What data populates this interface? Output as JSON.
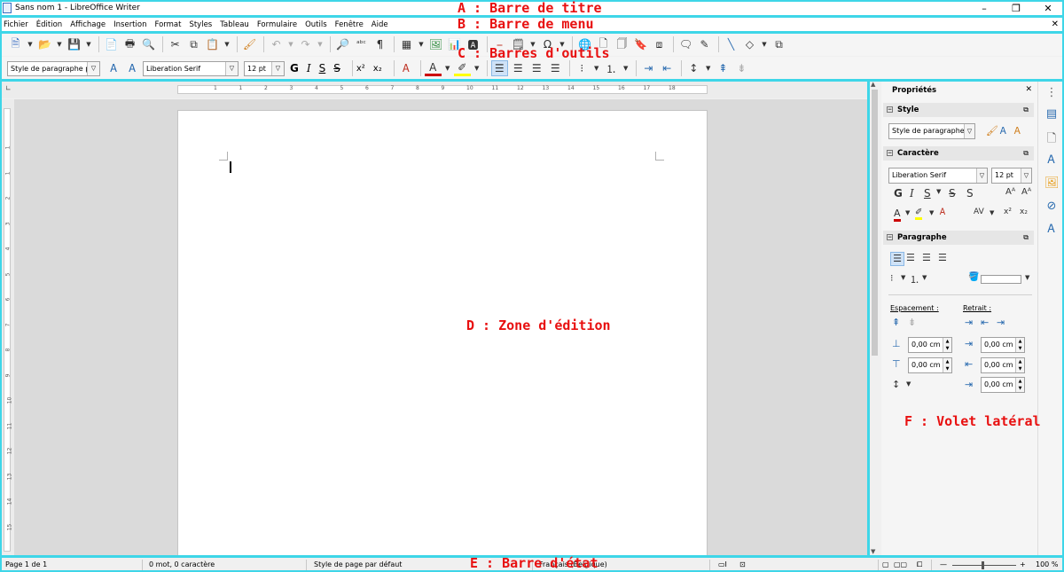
{
  "window": {
    "title": "Sans nom 1 - LibreOffice Writer",
    "minimize": "–",
    "restore": "❐",
    "close": "✕"
  },
  "menu": {
    "items": [
      "Fichier",
      "Édition",
      "Affichage",
      "Insertion",
      "Format",
      "Styles",
      "Tableau",
      "Formulaire",
      "Outils",
      "Fenêtre",
      "Aide"
    ],
    "close": "✕"
  },
  "toolbar": {
    "para_style": "Style de paragraphe par",
    "font_name": "Liberation Serif",
    "font_size": "12 pt",
    "bold": "G",
    "italic": "I",
    "underline": "S",
    "strike": "S",
    "superscript": "x²",
    "subscript": "x₂"
  },
  "ruler": {
    "numbers": [
      "1",
      "1",
      "2",
      "3",
      "4",
      "5",
      "6",
      "7",
      "8",
      "9",
      "10",
      "11",
      "12",
      "13",
      "14",
      "15",
      "16",
      "17",
      "18"
    ],
    "vnumbers": [
      "1",
      "1",
      "2",
      "3",
      "4",
      "5",
      "6",
      "7",
      "8",
      "9",
      "10",
      "11",
      "12",
      "13",
      "14",
      "15"
    ]
  },
  "sidebar": {
    "title": "Propriétés",
    "close": "✕",
    "style_section": "Style",
    "style_value": "Style de paragraphe p",
    "char_section": "Caractère",
    "font_name": "Liberation Serif",
    "font_size": "12 pt",
    "para_section": "Paragraphe",
    "spacing_label": "Espacement :",
    "indent_label": "Retrait :",
    "spacing_above": "0,00 cm",
    "spacing_below": "0,00 cm",
    "indent_before": "0,00 cm",
    "indent_after": "0,00 cm",
    "indent_first": "0,00 cm"
  },
  "status": {
    "page": "Page 1 de 1",
    "words": "0 mot, 0 caractère",
    "page_style": "Style de page par défaut",
    "language": "Français (Belgique)",
    "zoom": "100 %"
  },
  "annotations": {
    "a": "A : Barre de titre",
    "b": "B : Barre de menu",
    "c": "C : Barres d'outils",
    "d": "D : Zone d'édition",
    "e": "E : Barre d'état",
    "f": "F : Volet latéral"
  },
  "colors": {
    "frame": "#3ed6e8",
    "annotation": "#e81010",
    "accent": "#2b6cb0"
  }
}
